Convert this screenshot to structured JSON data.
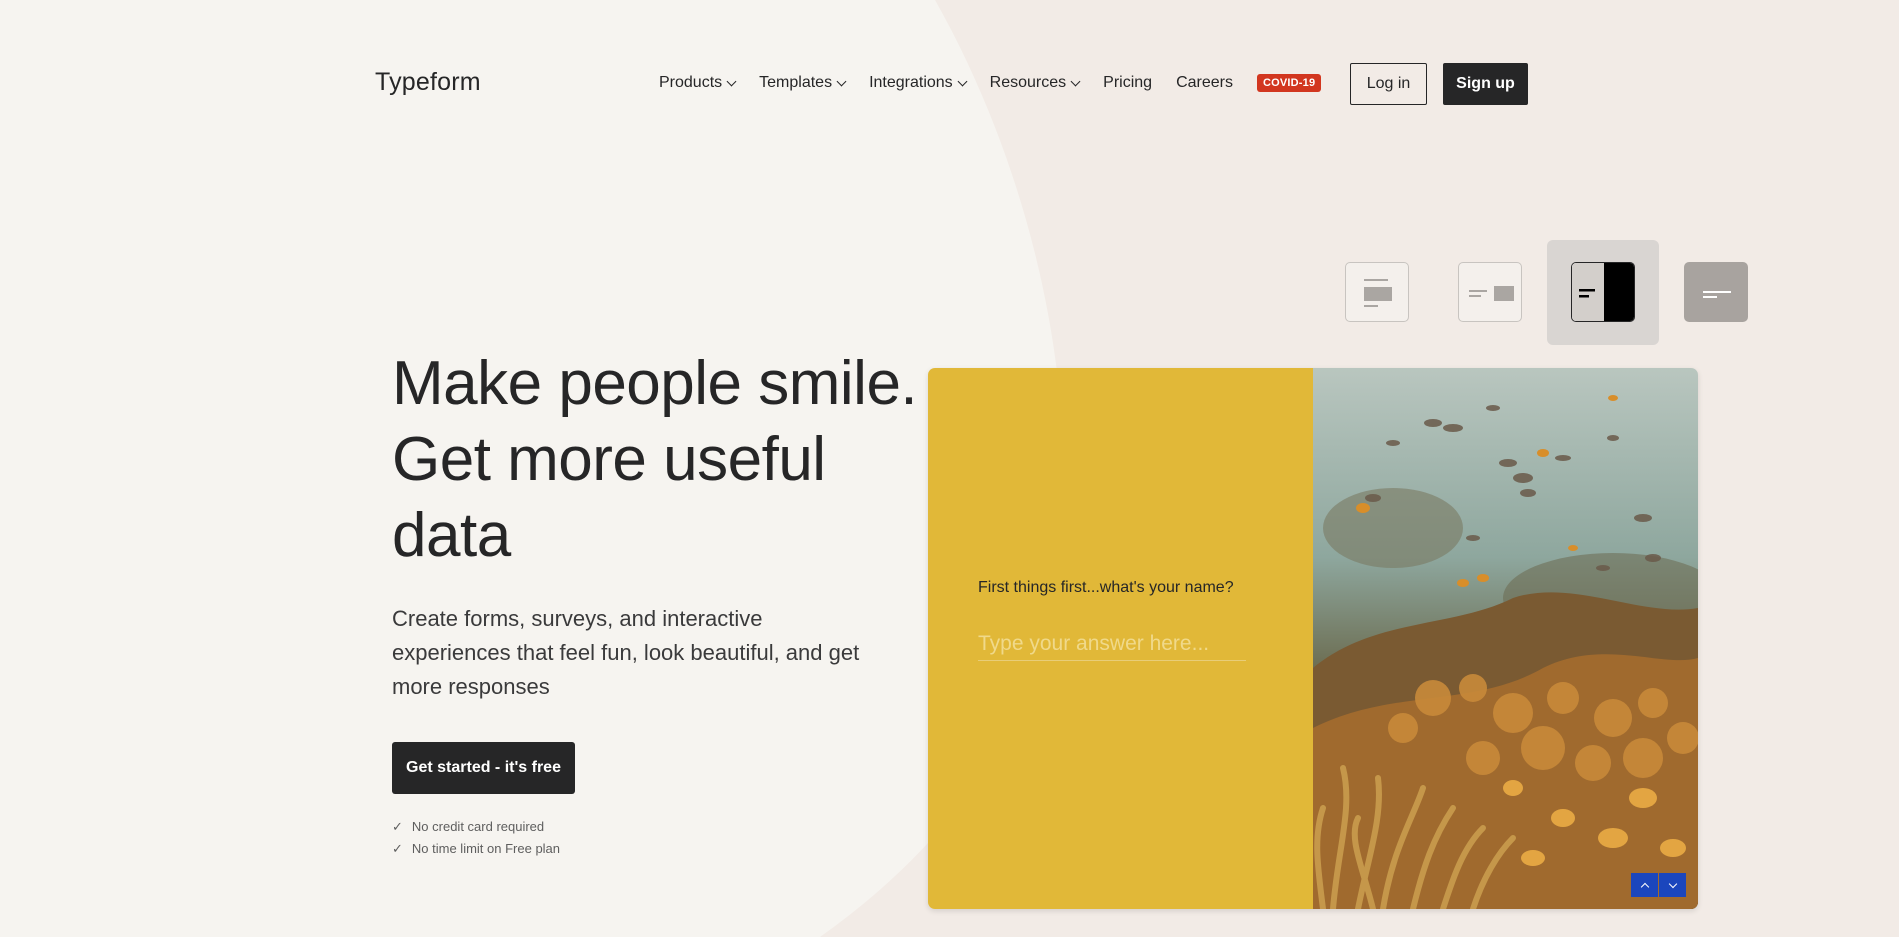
{
  "brand": {
    "logo": "Typeform"
  },
  "nav": {
    "items": [
      {
        "label": "Products",
        "dropdown": true
      },
      {
        "label": "Templates",
        "dropdown": true
      },
      {
        "label": "Integrations",
        "dropdown": true
      },
      {
        "label": "Resources",
        "dropdown": true
      },
      {
        "label": "Pricing",
        "dropdown": false
      },
      {
        "label": "Careers",
        "dropdown": false
      }
    ],
    "badge": "COVID-19",
    "login": "Log in",
    "signup": "Sign up"
  },
  "hero": {
    "headline": "Make people smile. Get more useful data",
    "subhead": "Create forms, surveys, and interactive experiences that feel fun, look beautiful, and get more responses",
    "cta": "Get started - it's free",
    "checks": [
      "No credit card required",
      "No time limit on Free plan"
    ]
  },
  "demo": {
    "question": "First things first...what's your name?",
    "answer_placeholder": "Type your answer here...",
    "layout_options": [
      "layout-stack-icon",
      "layout-split-icon",
      "layout-split-right-icon",
      "layout-wallpaper-icon"
    ],
    "active_layout": 2
  },
  "colors": {
    "background": "#f6f4f0",
    "accent_shape": "#f1e9e4",
    "dark": "#262627",
    "badge": "#d2361f",
    "form_yellow": "#e1b838",
    "arrow_blue": "#1b46bd"
  }
}
